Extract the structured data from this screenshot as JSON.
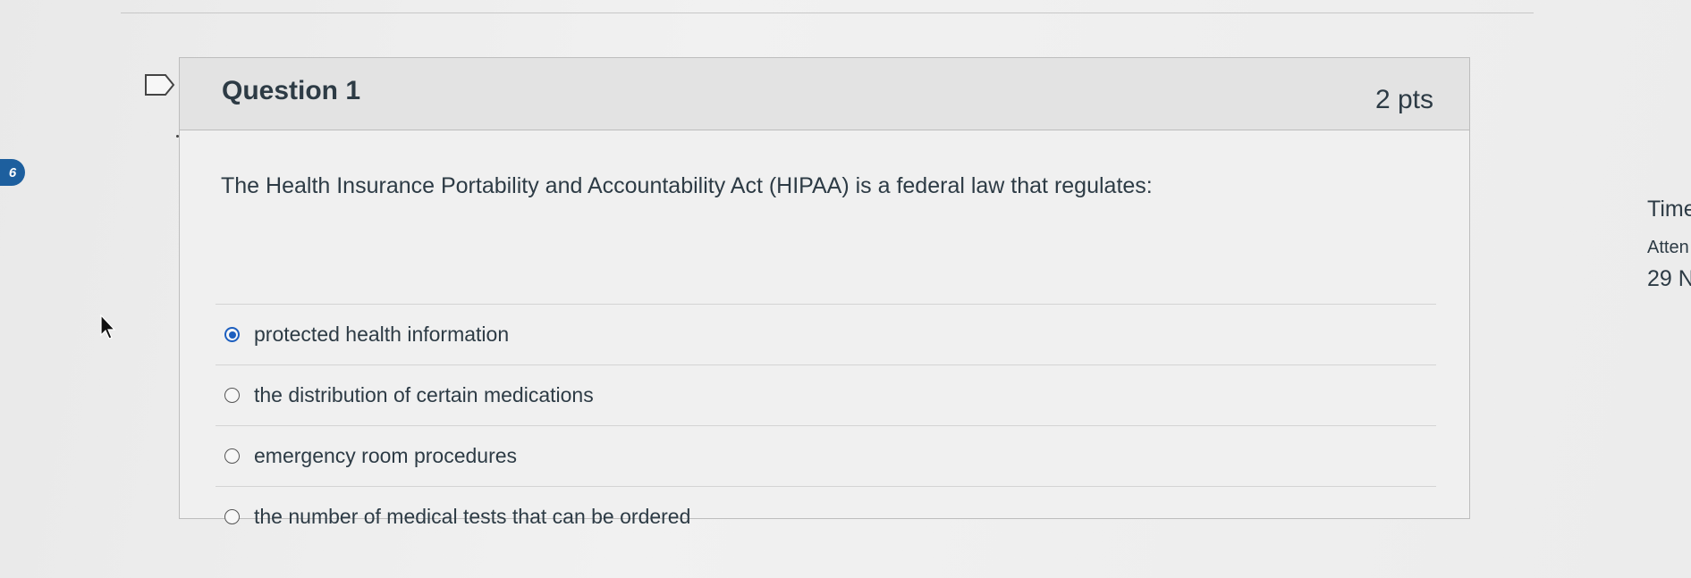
{
  "nav": {
    "badge": "6"
  },
  "question": {
    "title": "Question 1",
    "points": "2 pts",
    "text": "The Health Insurance Portability and Accountability Act (HIPAA) is a federal law that regulates:",
    "answers": [
      {
        "label": "protected health information",
        "selected": true
      },
      {
        "label": "the distribution of certain medications",
        "selected": false
      },
      {
        "label": "emergency room procedures",
        "selected": false
      },
      {
        "label": "the number of medical tests that can be ordered",
        "selected": false
      }
    ]
  },
  "sidebar": {
    "time_label": "Time",
    "attempt_label": "Atten",
    "date_text": "29 N"
  },
  "colors": {
    "accent": "#1d5fbf",
    "badge": "#1d5f9e",
    "text": "#2d3b45"
  },
  "icons": {
    "flag": "flag-icon",
    "cursor": "cursor-icon"
  }
}
